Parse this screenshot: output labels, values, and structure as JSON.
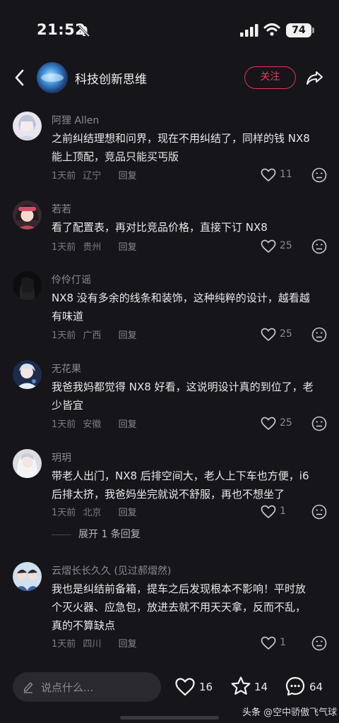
{
  "status_bar": {
    "time": "21:52",
    "battery": "74"
  },
  "header": {
    "channel_name": "科技创新思维",
    "follow_label": "关注"
  },
  "comments": [
    {
      "name": "阿狸 Allen",
      "lines": [
        "之前纠结理想和问界，现在不用纠结了，同样的钱 NX8",
        "能上顶配，竞品只能买丐版"
      ],
      "time": "1天前",
      "location": "辽宁",
      "reply": "回复",
      "likes": "11"
    },
    {
      "name": "若若",
      "lines": [
        "看了配置表，再对比竞品价格，直接下订 NX8"
      ],
      "time": "1天前",
      "location": "贵州",
      "reply": "回复",
      "likes": "25"
    },
    {
      "name": "伶伶仃谣",
      "lines": [
        "NX8 没有多余的线条和装饰，这种纯粹的设计，越看越",
        "有味道"
      ],
      "time": "1天前",
      "location": "广西",
      "reply": "回复",
      "likes": "25"
    },
    {
      "name": "无花果",
      "lines": [
        "我爸我妈都觉得 NX8 好看，这说明设计真的到位了，老",
        "少皆宜"
      ],
      "time": "1天前",
      "location": "安徽",
      "reply": "回复",
      "likes": "25"
    },
    {
      "name": "玥玥",
      "lines": [
        "带老人出门，NX8 后排空间大，老人上下车也方便，i6",
        "后排太挤，我爸妈坐完就说不舒服，再也不想坐了"
      ],
      "time": "1天前",
      "location": "北京",
      "reply": "回复",
      "likes": "1"
    },
    {
      "name": "云熠长长久久 (见过郝熠然)",
      "lines": [
        "我也是纠结前备箱，提车之后发现根本不影响！平时放",
        "个灭火器、应急包，放进去就不用天天拿，反而不乱，",
        "真的不算缺点"
      ],
      "time": "1天前",
      "location": "四川",
      "reply": "回复",
      "likes": "1"
    }
  ],
  "expand_replies": "展开 1 条回复",
  "bottom_bar": {
    "input_placeholder": "说点什么...",
    "likes": "16",
    "favorites": "14",
    "comments": "64"
  },
  "watermark": {
    "brand": "头条",
    "handle": "@空中骄傲飞气球"
  },
  "colors": {
    "background": "#161519",
    "accent": "#e8325a",
    "text_secondary": "#8b8a90"
  }
}
